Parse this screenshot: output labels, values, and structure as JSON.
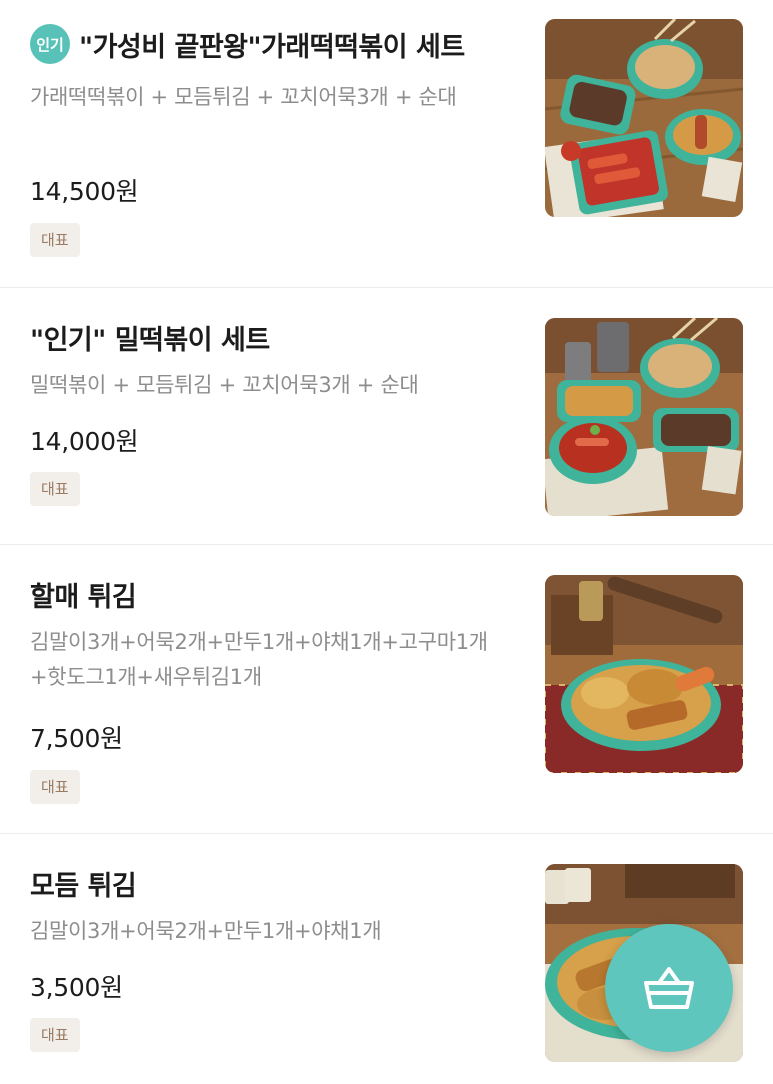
{
  "menu": {
    "items": [
      {
        "badge": "인기",
        "title": "\"가성비 끝판왕\"가래떡떡볶이 세트",
        "description": "가래떡떡볶이 + 모듬튀김 + 꼬치어묵3개 + 순대",
        "price": "14,500원",
        "tag": "대표",
        "image_icon": "food-photo-garaetteok-set"
      },
      {
        "title": "\"인기\" 밀떡볶이 세트",
        "description": "밀떡볶이 + 모듬튀김 + 꼬치어묵3개 + 순대",
        "price": "14,000원",
        "tag": "대표",
        "image_icon": "food-photo-milttok-set"
      },
      {
        "title": "할매 튀김",
        "description": "김말이3개+어묵2개+만두1개+야채1개+고구마1개+핫도그1개+새우튀김1개",
        "price": "7,500원",
        "tag": "대표",
        "image_icon": "food-photo-halmae-twigim"
      },
      {
        "title": "모듬 튀김",
        "description": "김말이3개+어묵2개+만두1개+야채1개",
        "price": "3,500원",
        "tag": "대표",
        "image_icon": "food-photo-modeum-twigim"
      }
    ]
  },
  "cart": {
    "icon": "shopping-basket-icon"
  },
  "colors": {
    "accent": "#58c2b8",
    "cart_button": "#5fc6bd",
    "tag_bg": "#f2efeb",
    "tag_text": "#9a7a62",
    "desc_text": "#8d8d8d"
  }
}
